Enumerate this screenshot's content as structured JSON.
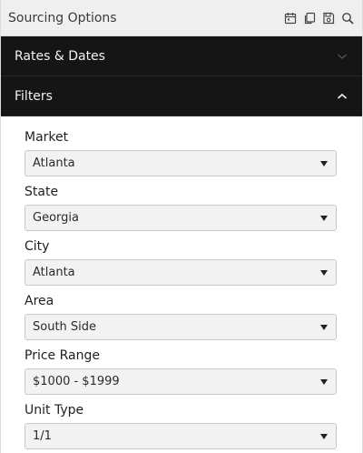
{
  "header": {
    "title": "Sourcing Options",
    "icons": [
      "calendar-icon",
      "copy-icon",
      "save-icon",
      "search-icon"
    ]
  },
  "sections": {
    "rates_dates": {
      "label": "Rates & Dates",
      "expanded": false
    },
    "filters": {
      "label": "Filters",
      "expanded": true
    }
  },
  "filters": [
    {
      "label": "Market",
      "value": "Atlanta"
    },
    {
      "label": "State",
      "value": "Georgia"
    },
    {
      "label": "City",
      "value": "Atlanta"
    },
    {
      "label": "Area",
      "value": "South Side"
    },
    {
      "label": "Price Range",
      "value": "$1000 - $1999"
    },
    {
      "label": "Unit Type",
      "value": "1/1"
    }
  ],
  "colors": {
    "header_bg": "#efefef",
    "section_bg": "#151515",
    "select_bg": "#f2f2f2"
  }
}
